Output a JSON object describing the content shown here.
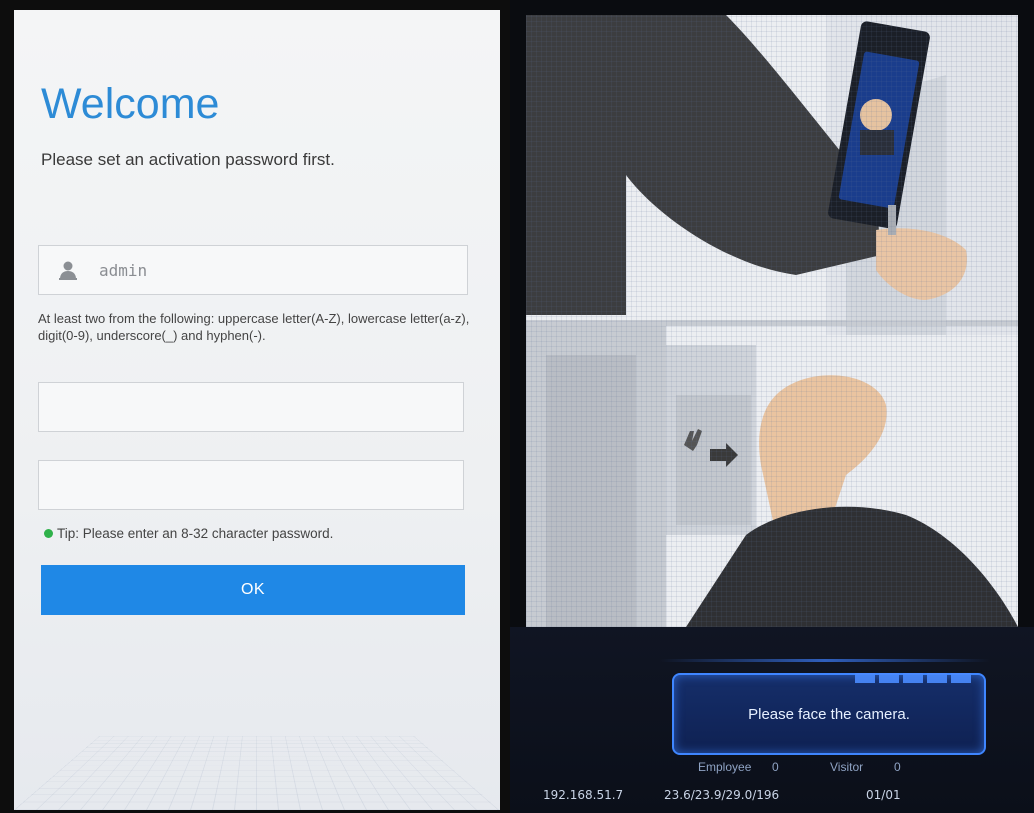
{
  "activation": {
    "title": "Welcome",
    "subtitle": "Please set an activation password first.",
    "username_value": "admin",
    "password_rules": "At least two from the following: uppercase letter(A-Z), lowercase letter(a-z), digit(0-9), underscore(_) and hyphen(-).",
    "password_placeholder": "",
    "confirm_placeholder": "",
    "tip": "Tip: Please enter an 8-32 character password.",
    "ok_label": "OK"
  },
  "terminal": {
    "prompt": "Please face the camera.",
    "employee_label": "Employee",
    "employee_count": "0",
    "visitor_label": "Visitor",
    "visitor_count": "0",
    "ip_address": "192.168.51.7",
    "temperature": "23.6/23.9/29.0/196",
    "page": "01/01"
  },
  "colors": {
    "brand_blue": "#2d8bd6",
    "button_blue": "#1f88e6",
    "tip_green": "#2fb14a",
    "prompt_border": "#3f86ff"
  }
}
